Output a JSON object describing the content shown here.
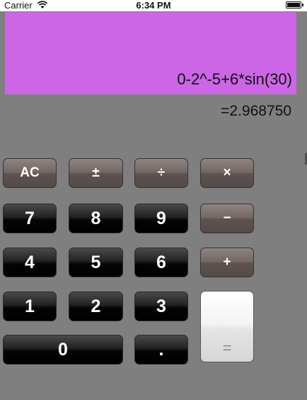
{
  "status_bar": {
    "carrier": "Carrier",
    "time": "6:34 PM",
    "wifi_icon": "wifi-icon",
    "battery_icon": "battery-icon"
  },
  "display": {
    "background": "#cc66e6",
    "expression": "0-2^-5+6*sin(30)",
    "result": "=2.968750"
  },
  "keys": {
    "ac": "AC",
    "plus_minus": "±",
    "divide": "÷",
    "multiply": "×",
    "seven": "7",
    "eight": "8",
    "nine": "9",
    "minus": "−",
    "four": "4",
    "five": "5",
    "six": "6",
    "plus": "+",
    "one": "1",
    "two": "2",
    "three": "3",
    "equals": "=",
    "zero": "0",
    "decimal": "."
  },
  "colors": {
    "background": "#7f7f7f",
    "operator_key": "#6e6360",
    "number_key": "#111111",
    "equals_key": "#eeeeee"
  }
}
